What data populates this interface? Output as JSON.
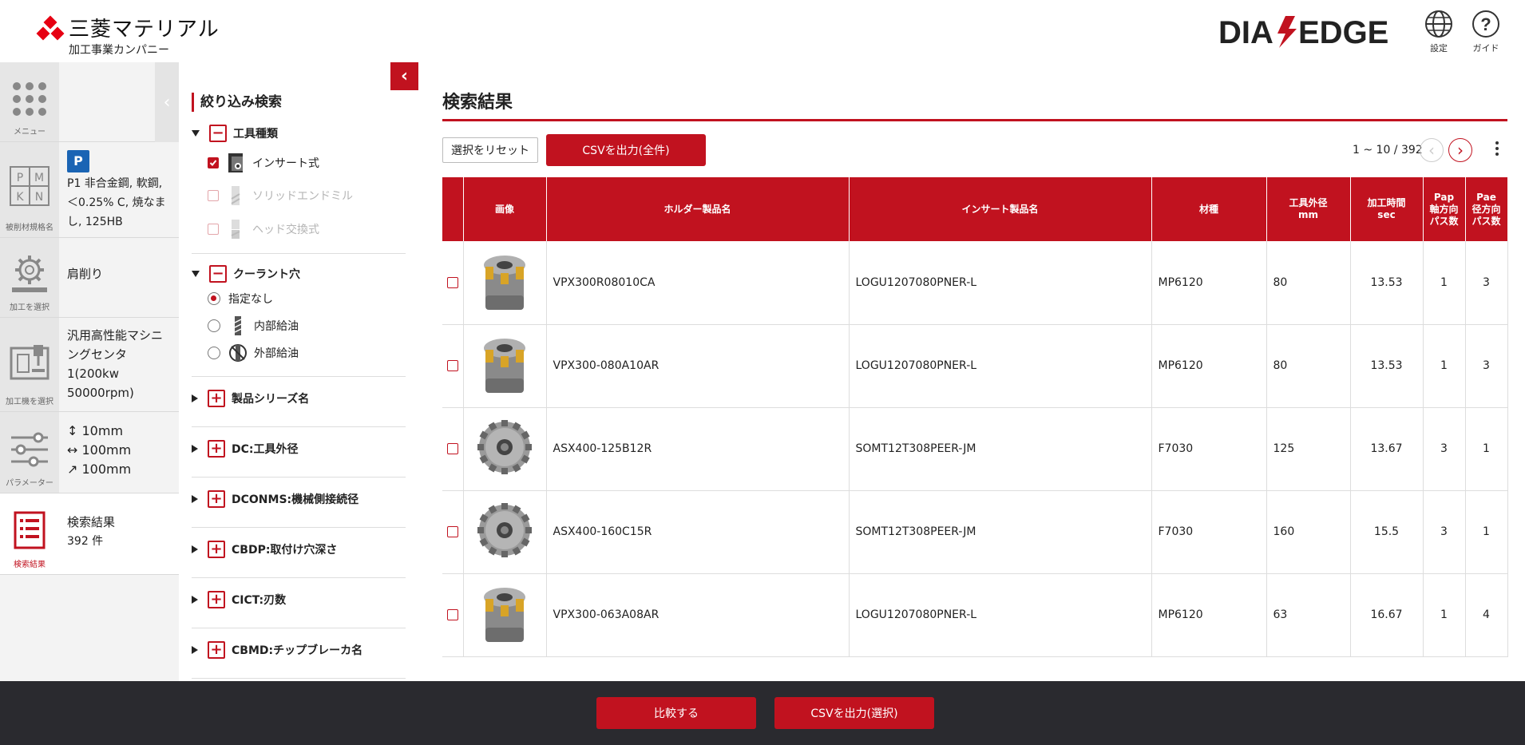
{
  "header": {
    "brand_name": "三菱マテリアル",
    "brand_sub": "加工事業カンパニー",
    "logo_text": "DIAEDGE",
    "settings_label": "設定",
    "guide_label": "ガイド"
  },
  "nav": {
    "items": [
      {
        "caption": "メニュー",
        "text": ""
      },
      {
        "caption": "被削材規格名",
        "badge": "P",
        "text": "P1 非合金鋼, 軟鋼, ＜0.25% C, 焼なまし, 125HB"
      },
      {
        "caption": "加工を選択",
        "text": "肩削り"
      },
      {
        "caption": "加工機を選択",
        "text": "汎用高性能マシニングセンタ1(200kw 50000rpm)"
      },
      {
        "caption": "パラメーター",
        "lines": [
          "↕ 10mm",
          "↔ 100mm",
          "↗ 100mm"
        ]
      },
      {
        "caption": "検索結果",
        "lines": [
          "検索結果",
          "392 件"
        ]
      }
    ],
    "pmkn": [
      "P",
      "M",
      "K",
      "N"
    ]
  },
  "filter": {
    "title": "絞り込み検索",
    "tool_type": {
      "label": "工具種類",
      "options": [
        {
          "label": "インサート式",
          "checked": true,
          "disabled": false
        },
        {
          "label": "ソリッドエンドミル",
          "checked": false,
          "disabled": true
        },
        {
          "label": "ヘッド交換式",
          "checked": false,
          "disabled": true
        }
      ]
    },
    "coolant": {
      "label": "クーラント穴",
      "options": [
        {
          "label": "指定なし",
          "checked": true
        },
        {
          "label": "内部給油",
          "checked": false
        },
        {
          "label": "外部給油",
          "checked": false
        }
      ]
    },
    "collapsed_groups": [
      "製品シリーズ名",
      "DC:工具外径",
      "DCONMS:機械側接続径",
      "CBDP:取付け穴深さ",
      "CICT:刃数",
      "CBMD:チップブレーカ名"
    ]
  },
  "main": {
    "title": "検索結果",
    "reset_label": "選択をリセット",
    "csv_all_label": "CSVを出力(全件)",
    "pager": "1 ~ 10 / 392",
    "columns": [
      "",
      "画像",
      "ホルダー製品名",
      "インサート製品名",
      "材種",
      "工具外径 mm",
      "加工時間 sec",
      "Pap 軸方向パス数",
      "Pae 径方向パス数"
    ],
    "rows": [
      {
        "holder": "VPX300R08010CA",
        "insert": "LOGU1207080PNER-L",
        "grade": "MP6120",
        "dc": "80",
        "time": "13.53",
        "pap": "1",
        "pae": "3",
        "img": "vpx"
      },
      {
        "holder": "VPX300-080A10AR",
        "insert": "LOGU1207080PNER-L",
        "grade": "MP6120",
        "dc": "80",
        "time": "13.53",
        "pap": "1",
        "pae": "3",
        "img": "vpx"
      },
      {
        "holder": "ASX400-125B12R",
        "insert": "SOMT12T308PEER-JM",
        "grade": "F7030",
        "dc": "125",
        "time": "13.67",
        "pap": "3",
        "pae": "1",
        "img": "asx"
      },
      {
        "holder": "ASX400-160C15R",
        "insert": "SOMT12T308PEER-JM",
        "grade": "F7030",
        "dc": "160",
        "time": "15.5",
        "pap": "3",
        "pae": "1",
        "img": "asx"
      },
      {
        "holder": "VPX300-063A08AR",
        "insert": "LOGU1207080PNER-L",
        "grade": "MP6120",
        "dc": "63",
        "time": "16.67",
        "pap": "1",
        "pae": "4",
        "img": "vpx"
      }
    ]
  },
  "footer": {
    "compare_label": "比較する",
    "csv_selected_label": "CSVを出力(選択)"
  },
  "colors": {
    "accent": "#c1121f",
    "footer_bg": "#2a2a2f"
  }
}
